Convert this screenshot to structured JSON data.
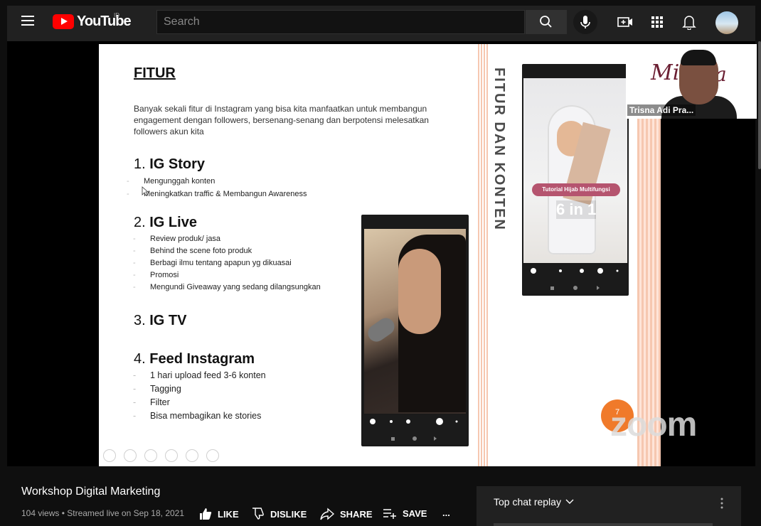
{
  "header": {
    "brand": "YouTube",
    "country": "ID",
    "search_placeholder": "Search"
  },
  "slide": {
    "title": "FITUR",
    "intro": "Banyak sekali fitur di Instagram yang bisa kita manfaatkan untuk membangun engagement dengan followers, bersenang-senang dan berpotensi melesatkan followers akun kita",
    "sections": [
      {
        "num": "1.",
        "name": "IG Story",
        "items": [
          "Mengunggah konten",
          "Meningkatkan traffic & Membangun Awareness"
        ]
      },
      {
        "num": "2.",
        "name": "IG Live",
        "items": [
          "Review produk/ jasa",
          "Behind the scene foto produk",
          "Berbagi ilmu tentang apapun yg dikuasai",
          "Promosi",
          "Mengundi Giveaway yang sedang dilangsungkan"
        ]
      },
      {
        "num": "3.",
        "name": "IG TV",
        "items": []
      },
      {
        "num": "4.",
        "name": "Feed Instagram",
        "items": [
          "1 hari upload feed 3-6 konten",
          "Tagging",
          "Filter",
          "Bisa membagikan ke stories"
        ]
      }
    ],
    "vertical_title": "FITUR DAN KONTEN",
    "phone2_banner": "Tutorial Hijab Multifungsi",
    "phone2_big": "6 in 1",
    "page_number": "7"
  },
  "presenter": {
    "name": "Trisna Adi Pra...",
    "logo_left": "Mil",
    "logo_right": "a"
  },
  "zoom_watermark": "zoom",
  "video": {
    "title": "Workshop Digital Marketing",
    "meta": "104 views • Streamed live on Sep 18, 2021",
    "actions": {
      "like": "LIKE",
      "dislike": "DISLIKE",
      "share": "SHARE",
      "save": "SAVE",
      "more": "..."
    }
  },
  "chat": {
    "title": "Top chat replay"
  }
}
